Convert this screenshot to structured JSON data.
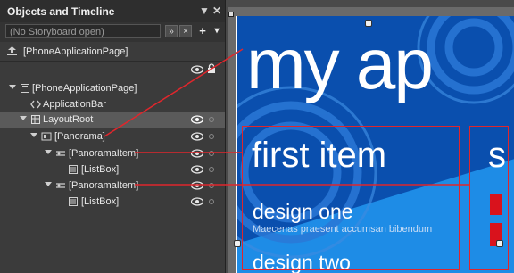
{
  "panel": {
    "title": "Objects and Timeline",
    "pin_glyph": "▼",
    "close_glyph": "✕",
    "storyboard_placeholder": "(No Storyboard open)",
    "collapse_glyph": "»",
    "close_story_glyph": "×",
    "add_glyph": "+",
    "menu_glyph": "▾",
    "page_label": "[PhoneApplicationPage]",
    "tree": [
      {
        "label": "[PhoneApplicationPage]"
      },
      {
        "label": "ApplicationBar"
      },
      {
        "label": "LayoutRoot"
      },
      {
        "label": "[Panorama]"
      },
      {
        "label": "[PanoramaItem]"
      },
      {
        "label": "[ListBox]"
      },
      {
        "label": "[PanoramaItem]"
      },
      {
        "label": "[ListBox]"
      }
    ]
  },
  "canvas": {
    "panorama_title": "my ap",
    "item1_title": "first item",
    "item2_title_partial": "s",
    "design_one": "design one",
    "design_one_sub": "Maecenas praesent accumsan bibendum",
    "design_two": "design two"
  },
  "colors": {
    "panel_bg": "#3b3b3b",
    "phone_bg": "#0a4fae",
    "accent_blue": "#1e8ce6",
    "annotation_red": "#e0262c"
  }
}
